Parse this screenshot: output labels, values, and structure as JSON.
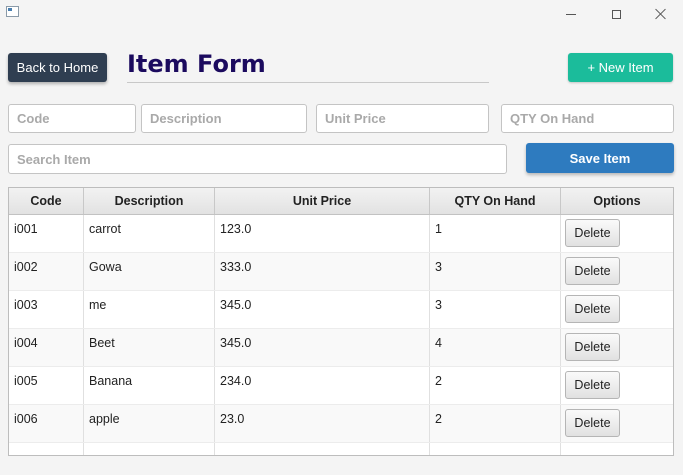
{
  "window": {
    "minimize_icon": "minimize-icon",
    "maximize_icon": "maximize-icon",
    "close_icon": "close-icon"
  },
  "header": {
    "back_button": "Back to Home",
    "title": "Item Form",
    "new_button": "+ New Item"
  },
  "form": {
    "code_placeholder": "Code",
    "description_placeholder": "Description",
    "unit_price_placeholder": "Unit Price",
    "qty_placeholder": "QTY On Hand",
    "search_placeholder": "Search Item",
    "save_button": "Save Item"
  },
  "table": {
    "columns": [
      "Code",
      "Description",
      "Unit Price",
      "QTY On Hand",
      "Options"
    ],
    "rows": [
      {
        "code": "i001",
        "description": "carrot",
        "unit_price": "123.0",
        "qty": "1",
        "action": "Delete"
      },
      {
        "code": "i002",
        "description": "Gowa",
        "unit_price": "333.0",
        "qty": "3",
        "action": "Delete"
      },
      {
        "code": "i003",
        "description": "me",
        "unit_price": "345.0",
        "qty": "3",
        "action": "Delete"
      },
      {
        "code": "i004",
        "description": "Beet",
        "unit_price": "345.0",
        "qty": "4",
        "action": "Delete"
      },
      {
        "code": "i005",
        "description": "Banana",
        "unit_price": "234.0",
        "qty": "2",
        "action": "Delete"
      },
      {
        "code": "i006",
        "description": "apple",
        "unit_price": "23.0",
        "qty": "2",
        "action": "Delete"
      }
    ]
  },
  "colors": {
    "back_button": "#2f3e51",
    "title": "#1b0a5e",
    "new_button": "#1bbc9b",
    "save_button": "#2e7bbf"
  }
}
